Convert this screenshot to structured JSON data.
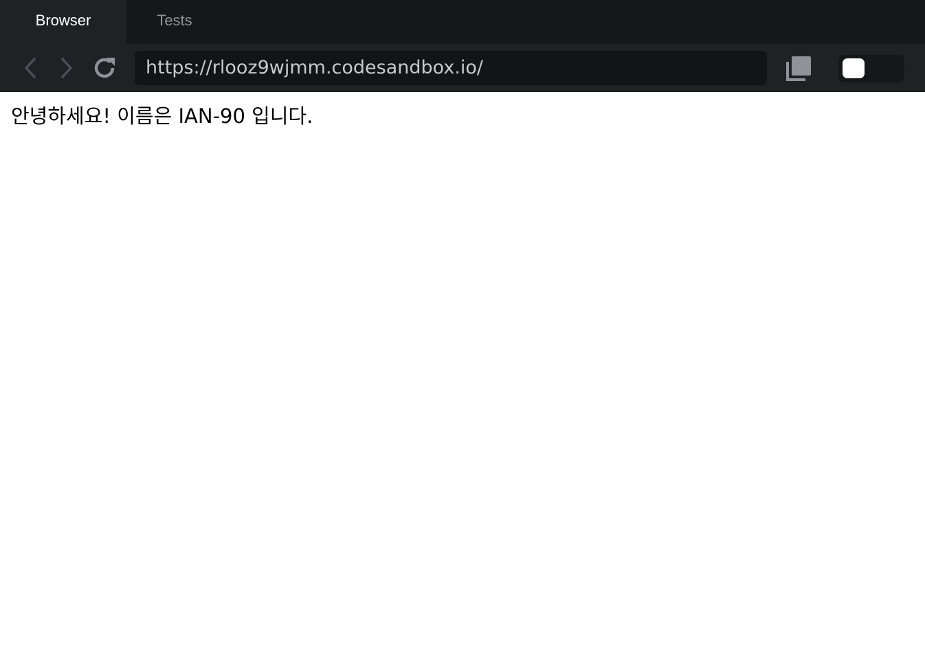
{
  "tabs": [
    {
      "label": "Browser",
      "active": true
    },
    {
      "label": "Tests",
      "active": false
    }
  ],
  "toolbar": {
    "back_icon": "chevron-left-icon",
    "forward_icon": "chevron-right-icon",
    "reload_icon": "reload-icon",
    "url": "https://rlooz9wjmm.codesandbox.io/",
    "open_new_window_icon": "open-new-window-icon",
    "toggle_state": "off"
  },
  "page": {
    "greeting": "안녕하세요! 이름은 IAN-90 입니다."
  },
  "colors": {
    "tabbar_bg": "#151719",
    "toolbar_bg": "#1f2225",
    "url_bg": "#121416",
    "icon_gray": "#8f9296"
  }
}
